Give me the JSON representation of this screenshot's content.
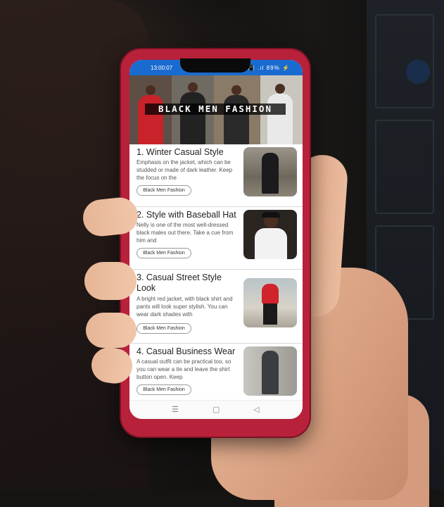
{
  "status": {
    "time": "13:00:07",
    "icons": "⏰ 📳 .ıl 89% ⚡"
  },
  "banner": {
    "title": "BLACK MEN FASHION"
  },
  "articles": [
    {
      "title": "1. Winter Casual Style",
      "desc": "Emphasis on the jacket, which can be studded or made of dark leather. Keep the focus on the",
      "tag": "Black Men Fashion"
    },
    {
      "title": "2. Style with Baseball Hat",
      "desc": "Nelly is one of the most well-dressed black males out there. Take a cue from him and",
      "tag": "Black Men Fashion"
    },
    {
      "title": "3. Casual Street Style Look",
      "desc": "A bright red jacket, with black shirt and pants will look super stylish. You can wear dark shades with",
      "tag": "Black Men Fashion"
    },
    {
      "title": "4. Casual Business Wear",
      "desc": "A casual outfit can be practical too, so you can wear a tie and leave the shirt button open. Keep",
      "tag": "Black Men Fashion"
    }
  ],
  "nav": {
    "menu": "☰",
    "home": "▢",
    "back": "◁"
  },
  "colors": {
    "statusbar": "#1a6bcf",
    "phone": "#b8213a"
  }
}
